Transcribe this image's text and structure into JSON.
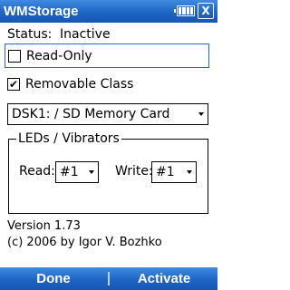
{
  "titlebar": {
    "title": "WMStorage",
    "close_label": "X"
  },
  "status": {
    "label": "Status:",
    "value": "Inactive"
  },
  "read_only": {
    "label": "Read-Only",
    "checked": false
  },
  "removable_class": {
    "label": "Removable Class",
    "checked": true,
    "check_glyph": "✔"
  },
  "device_select": {
    "value": "DSK1: / SD Memory Card"
  },
  "leds_group": {
    "legend": "LEDs / Vibrators",
    "read_label": "Read:",
    "read_value": "#1",
    "write_label": "Write:",
    "write_value": "#1"
  },
  "about": {
    "version": "Version 1.73",
    "copyright": "(c) 2006 by Igor V. Bozhko"
  },
  "softkeys": {
    "left_label": "Done",
    "right_label": "Activate"
  }
}
